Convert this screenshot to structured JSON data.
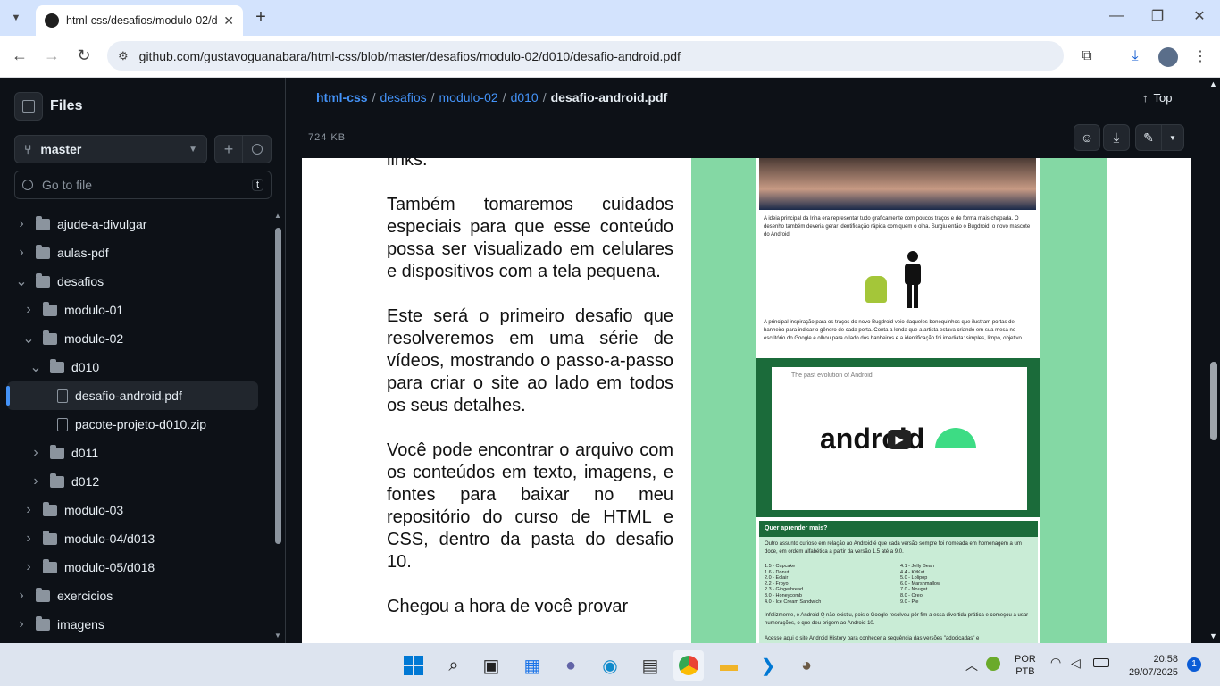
{
  "browser": {
    "tab_title": "html-css/desafios/modulo-02/d",
    "url": "github.com/gustavoguanabara/html-css/blob/master/desafios/modulo-02/d010/desafio-android.pdf"
  },
  "sidebar": {
    "title": "Files",
    "branch": "master",
    "search_placeholder": "Go to file",
    "search_shortcut": "t",
    "items": [
      {
        "label": "ajude-a-divulgar",
        "type": "folder",
        "level": 0,
        "expanded": false
      },
      {
        "label": "aulas-pdf",
        "type": "folder",
        "level": 0,
        "expanded": false
      },
      {
        "label": "desafios",
        "type": "folder",
        "level": 0,
        "expanded": true
      },
      {
        "label": "modulo-01",
        "type": "folder",
        "level": 1,
        "expanded": false
      },
      {
        "label": "modulo-02",
        "type": "folder",
        "level": 1,
        "expanded": true
      },
      {
        "label": "d010",
        "type": "folder",
        "level": 2,
        "expanded": true
      },
      {
        "label": "desafio-android.pdf",
        "type": "file",
        "level": 3,
        "selected": true
      },
      {
        "label": "pacote-projeto-d010.zip",
        "type": "file",
        "level": 3
      },
      {
        "label": "d011",
        "type": "folder",
        "level": 2,
        "expanded": false
      },
      {
        "label": "d012",
        "type": "folder",
        "level": 2,
        "expanded": false
      },
      {
        "label": "modulo-03",
        "type": "folder",
        "level": 1,
        "expanded": false
      },
      {
        "label": "modulo-04/d013",
        "type": "folder",
        "level": 1,
        "expanded": false
      },
      {
        "label": "modulo-05/d018",
        "type": "folder",
        "level": 1,
        "expanded": false
      },
      {
        "label": "exercicios",
        "type": "folder",
        "level": 0,
        "expanded": false
      },
      {
        "label": "imagens",
        "type": "folder",
        "level": 0,
        "expanded": false
      }
    ]
  },
  "header": {
    "crumbs": [
      "html-css",
      "desafios",
      "modulo-02",
      "d010"
    ],
    "current": "desafio-android.pdf",
    "top_label": "Top",
    "size": "724 KB"
  },
  "pdf": {
    "paragraphs": [
      "links.",
      "Também tomaremos cuidados especiais para que esse conteúdo possa ser visualizado em celulares e dispositivos com a tela pequena.",
      "Este será o primeiro desafio que resolveremos em uma série de vídeos, mostrando o passo-a-passo para criar o site ao lado em todos os seus detalhes.",
      "Você pode encontrar o arquivo com os conteúdos em texto, imagens, e fontes para baixar no meu repositório do curso de HTML e CSS, dentro da pasta do desafio 10.",
      "Chegou a hora de você provar"
    ],
    "preview": {
      "caption1": "A ideia principal da Irina era representar tudo graficamente com poucos traços e de forma mais chapada. O desenho também deveria gerar identificação rápida com quem o olha. Surgiu então o Bugdroid, o novo mascote do Android.",
      "caption2": "A principal inspiração para os traços do novo Bugdroid veio daqueles bonequinhos que ilustram portas de banheiro para indicar o gênero de cada porta. Conta a lenda que a artista estava criando em sua mesa no escritório do Google e olhou para o lado dos banheiros e a identificação foi imediata: simples, limpo, objetivo.",
      "video_title": "The past evolution of Android",
      "video_logo": "android",
      "box_title": "Quer aprender mais?",
      "box_text": "Outro assunto curioso em relação ao Android é que cada versão sempre foi nomeada em homenagem a um doce, em ordem alfabética a partir da versão 1.5 até a 9.0.",
      "versions_left": [
        "1.5 - Cupcake",
        "1.6 - Donut",
        "2.0 - Eclair",
        "2.2 - Froyo",
        "2.3 - Gingerbread",
        "3.0 - Honeycomb",
        "4.0 - Ice Cream Sandwich"
      ],
      "versions_right": [
        "4.1 - Jelly Bean",
        "4.4 - KitKat",
        "5.0 - Lolipop",
        "6.0 - Marshmallow",
        "7.0 - Nougat",
        "8.0 - Oreo",
        "9.0 - Pie"
      ],
      "box_text2": "Infelizmente, o Android Q não existiu, pois o Google resolveu pôr fim a essa divertida prática e começou a usar numerações, o que deu origem ao Android 10.",
      "box_text3": "Acesse aqui o site Android History para conhecer a sequência das versões \"adocicadas\" e"
    }
  },
  "taskbar": {
    "lang1": "POR",
    "lang2": "PTB",
    "time": "20:58",
    "date": "29/07/2025",
    "badge": "1"
  },
  "colors": {
    "accent": "#4493f8",
    "bg": "#0d1117",
    "green": "#84d8a4",
    "android": "#3ddc84"
  }
}
